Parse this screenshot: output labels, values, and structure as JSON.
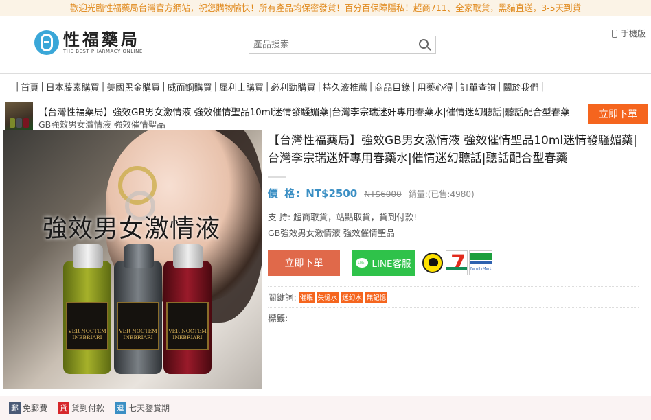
{
  "announcement": "歡迎光臨性福藥局台灣官方網站，祝您購物愉快！所有產品均保密發貨！百分百保障隱私！超商711、全家取貨，黑貓直送，3-5天到貨",
  "header": {
    "logo_cn": "性福藥局",
    "logo_en": "THE BEST PHARMACY ONLINE",
    "search_placeholder": "產品搜索",
    "mobile_label": "手機版"
  },
  "nav": {
    "items": [
      "首頁",
      "日本藤素購買",
      "美國黑金購買",
      "威而鋼購買",
      "犀利士購買",
      "必利勁購買",
      "持久液推薦",
      "商品目錄",
      "用藥心得",
      "訂單查詢",
      "關於我們"
    ]
  },
  "sticky": {
    "title": "【台灣性福藥局】強效GB男女激情液 強效催情聖品10ml迷情發騷媚藥|台灣李宗瑞迷奸專用春藥水|催情迷幻聽話|聽話配合型春藥",
    "subtitle": "GB強效男女激情液 強效催情聖品",
    "buy_label": "立即下單"
  },
  "product_image": {
    "overlay_text": "強效男女激情液",
    "bottle_label": "VER NOCTEM INEBRIARI"
  },
  "product": {
    "title": "【台灣性福藥局】強效GB男女激情液 強效催情聖品10ml迷情發騷媚藥|台灣李宗瑞迷奸專用春藥水|催情迷幻聽話|聽話配合型春藥",
    "price_label": "價 格:",
    "price": "NT$2500",
    "old_price": "NT$6000",
    "sales": "銷量:(已售:4980)",
    "support": "支 持:  超商取貨，站點取貨，貨到付款!",
    "subtitle": "GB強效男女激情液 強效催情聖品",
    "buy_label": "立即下單",
    "line_label": "LINE客服",
    "family_label": "FamilyMart",
    "keywords_label": "關鍵詞:",
    "keywords": [
      "催眠",
      "失憶水",
      "迷幻水",
      "無記憶"
    ],
    "tags_label": "標籤:"
  },
  "footer": {
    "badges": [
      {
        "icon": "郵",
        "label": "免郵費",
        "color": "#4a5a76"
      },
      {
        "icon": "貨",
        "label": "貨到付款",
        "color": "#d6262a"
      },
      {
        "icon": "退",
        "label": "七天鑒賞期",
        "color": "#3b8fc4"
      }
    ]
  }
}
